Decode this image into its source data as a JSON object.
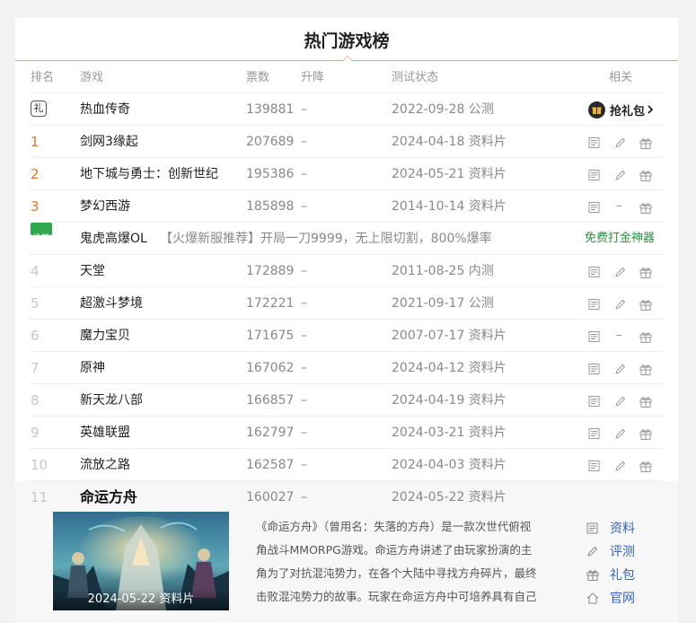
{
  "title": "热门游戏榜",
  "columns": {
    "rank": "排名",
    "game": "游戏",
    "votes": "票数",
    "trend": "升降",
    "status": "测试状态",
    "related": "相关"
  },
  "featured": {
    "name": "热血传奇",
    "votes": "139881",
    "trend": "–",
    "status": "2022-09-28 公测",
    "badge": "礼",
    "gift_label": "抢礼包"
  },
  "rows": [
    {
      "rank": "1",
      "name": "剑网3缘起",
      "votes": "207689",
      "trend": "–",
      "status": "2024-04-18 资料片",
      "review": true
    },
    {
      "rank": "2",
      "name": "地下城与勇士：创新世纪",
      "votes": "195386",
      "trend": "–",
      "status": "2024-05-21 资料片",
      "review": true
    },
    {
      "rank": "3",
      "name": "梦幻西游",
      "votes": "185898",
      "trend": "–",
      "status": "2014-10-14 资料片",
      "review": false
    },
    {
      "rank": "4",
      "name": "天堂",
      "votes": "172889",
      "trend": "–",
      "status": "2011-08-25 内测",
      "review": true
    },
    {
      "rank": "5",
      "name": "超激斗梦境",
      "votes": "172221",
      "trend": "–",
      "status": "2021-09-17 公测",
      "review": true
    },
    {
      "rank": "6",
      "name": "魔力宝贝",
      "votes": "171675",
      "trend": "–",
      "status": "2007-07-17 资料片",
      "review": false
    },
    {
      "rank": "7",
      "name": "原神",
      "votes": "167062",
      "trend": "–",
      "status": "2024-04-12 资料片",
      "review": true
    },
    {
      "rank": "8",
      "name": "新天龙八部",
      "votes": "166857",
      "trend": "–",
      "status": "2024-04-19 资料片",
      "review": true
    },
    {
      "rank": "9",
      "name": "英雄联盟",
      "votes": "162797",
      "trend": "–",
      "status": "2024-03-21 资料片",
      "review": true
    },
    {
      "rank": "10",
      "name": "流放之路",
      "votes": "162587",
      "trend": "–",
      "status": "2024-04-03 资料片",
      "review": true
    }
  ],
  "promo": {
    "badge": "推荐",
    "name": "鬼虎高爆OL",
    "text": "【火爆新服推荐】开局一刀9999，无上限切割，800%爆率",
    "link": "免费打金神器"
  },
  "expanded": {
    "rank": "11",
    "name": "命运方舟",
    "votes": "160027",
    "trend": "–",
    "status": "2024-05-22 资料片",
    "cover_caption": "2024-05-22 资料片",
    "description": "《命运方舟》（曾用名：失落的方舟）是一款次世代俯视角战斗MMORPG游戏。命运方舟讲述了由玩家扮演的主角为了对抗混沌势力，在各个大陆中寻找方舟碎片，最终击败混沌势力的故事。玩家在命运方舟中可培养具有自己独特个性",
    "links": {
      "info": "资料",
      "review": "评测",
      "gift": "礼包",
      "site": "官网"
    }
  },
  "colors": {
    "accent": "#e3a46a",
    "rank_top": "#e0742c",
    "link": "#3366bb",
    "promo": "#2fa84f"
  }
}
